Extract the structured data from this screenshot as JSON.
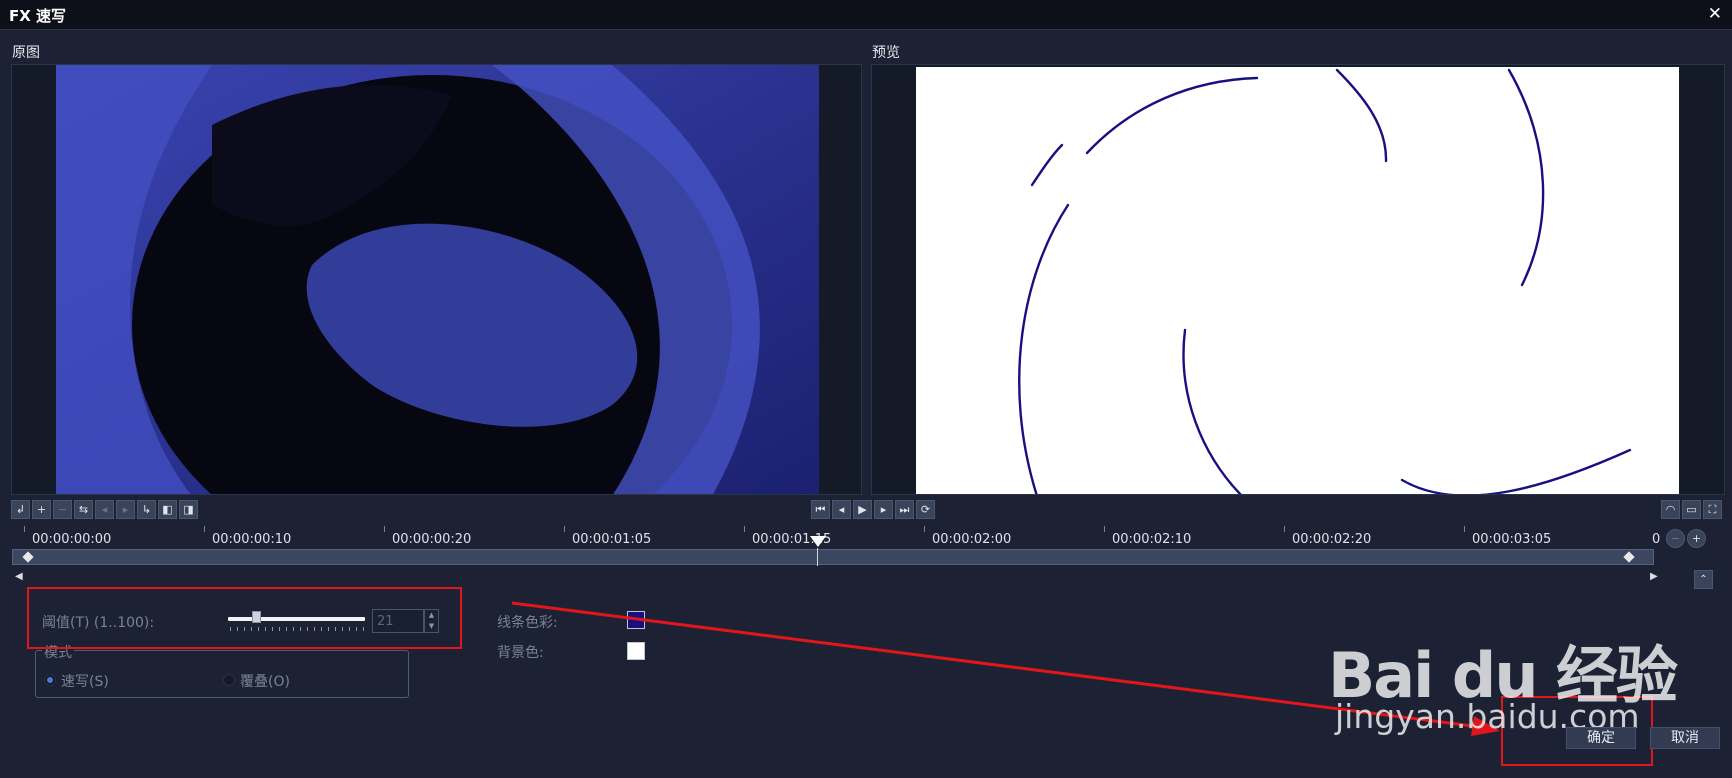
{
  "window": {
    "title": "FX 速写",
    "close_icon": "close-icon"
  },
  "panels": {
    "original_label": "原图",
    "preview_label": "预览"
  },
  "timeline": {
    "ticks": [
      "00:00:00:00",
      "00:00:00:10",
      "00:00:00:20",
      "00:00:01:05",
      "00:00:01:15",
      "00:00:02:00",
      "00:00:02:10",
      "00:00:02:20",
      "00:00:03:05",
      "0"
    ]
  },
  "params": {
    "threshold_label": "阈值(T) (1..100):",
    "threshold_value": "21",
    "threshold_level": 0.21,
    "mode_group_label": "模式",
    "mode_options": [
      "速写(S)",
      "覆叠(O)"
    ],
    "mode_selected": "速写(S)",
    "line_color_label": "线条色彩:",
    "line_color": "#1a0f80",
    "bg_color_label": "背景色:",
    "bg_color": "#ffffff"
  },
  "buttons": {
    "ok": "确定",
    "cancel": "取消"
  },
  "watermark": {
    "brand": "Bai du 经验",
    "url": "jingyan.baidu.com"
  }
}
